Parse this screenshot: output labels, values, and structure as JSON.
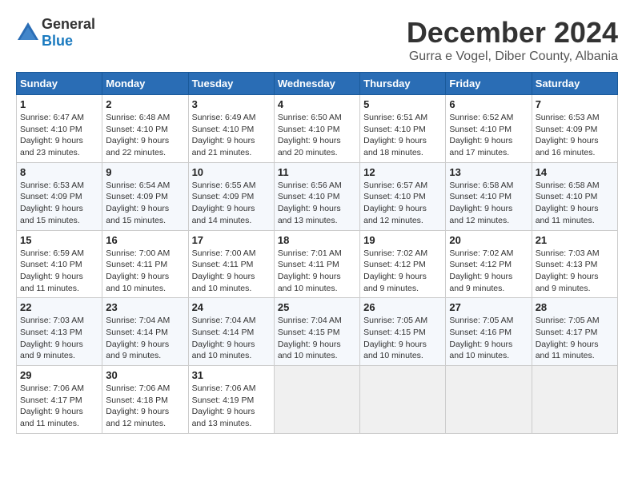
{
  "logo": {
    "general": "General",
    "blue": "Blue"
  },
  "title": "December 2024",
  "location": "Gurra e Vogel, Diber County, Albania",
  "headers": [
    "Sunday",
    "Monday",
    "Tuesday",
    "Wednesday",
    "Thursday",
    "Friday",
    "Saturday"
  ],
  "weeks": [
    [
      {
        "day": "1",
        "sunrise": "Sunrise: 6:47 AM",
        "sunset": "Sunset: 4:10 PM",
        "daylight": "Daylight: 9 hours and 23 minutes."
      },
      {
        "day": "2",
        "sunrise": "Sunrise: 6:48 AM",
        "sunset": "Sunset: 4:10 PM",
        "daylight": "Daylight: 9 hours and 22 minutes."
      },
      {
        "day": "3",
        "sunrise": "Sunrise: 6:49 AM",
        "sunset": "Sunset: 4:10 PM",
        "daylight": "Daylight: 9 hours and 21 minutes."
      },
      {
        "day": "4",
        "sunrise": "Sunrise: 6:50 AM",
        "sunset": "Sunset: 4:10 PM",
        "daylight": "Daylight: 9 hours and 20 minutes."
      },
      {
        "day": "5",
        "sunrise": "Sunrise: 6:51 AM",
        "sunset": "Sunset: 4:10 PM",
        "daylight": "Daylight: 9 hours and 18 minutes."
      },
      {
        "day": "6",
        "sunrise": "Sunrise: 6:52 AM",
        "sunset": "Sunset: 4:10 PM",
        "daylight": "Daylight: 9 hours and 17 minutes."
      },
      {
        "day": "7",
        "sunrise": "Sunrise: 6:53 AM",
        "sunset": "Sunset: 4:09 PM",
        "daylight": "Daylight: 9 hours and 16 minutes."
      }
    ],
    [
      {
        "day": "8",
        "sunrise": "Sunrise: 6:53 AM",
        "sunset": "Sunset: 4:09 PM",
        "daylight": "Daylight: 9 hours and 15 minutes."
      },
      {
        "day": "9",
        "sunrise": "Sunrise: 6:54 AM",
        "sunset": "Sunset: 4:09 PM",
        "daylight": "Daylight: 9 hours and 15 minutes."
      },
      {
        "day": "10",
        "sunrise": "Sunrise: 6:55 AM",
        "sunset": "Sunset: 4:09 PM",
        "daylight": "Daylight: 9 hours and 14 minutes."
      },
      {
        "day": "11",
        "sunrise": "Sunrise: 6:56 AM",
        "sunset": "Sunset: 4:10 PM",
        "daylight": "Daylight: 9 hours and 13 minutes."
      },
      {
        "day": "12",
        "sunrise": "Sunrise: 6:57 AM",
        "sunset": "Sunset: 4:10 PM",
        "daylight": "Daylight: 9 hours and 12 minutes."
      },
      {
        "day": "13",
        "sunrise": "Sunrise: 6:58 AM",
        "sunset": "Sunset: 4:10 PM",
        "daylight": "Daylight: 9 hours and 12 minutes."
      },
      {
        "day": "14",
        "sunrise": "Sunrise: 6:58 AM",
        "sunset": "Sunset: 4:10 PM",
        "daylight": "Daylight: 9 hours and 11 minutes."
      }
    ],
    [
      {
        "day": "15",
        "sunrise": "Sunrise: 6:59 AM",
        "sunset": "Sunset: 4:10 PM",
        "daylight": "Daylight: 9 hours and 11 minutes."
      },
      {
        "day": "16",
        "sunrise": "Sunrise: 7:00 AM",
        "sunset": "Sunset: 4:11 PM",
        "daylight": "Daylight: 9 hours and 10 minutes."
      },
      {
        "day": "17",
        "sunrise": "Sunrise: 7:00 AM",
        "sunset": "Sunset: 4:11 PM",
        "daylight": "Daylight: 9 hours and 10 minutes."
      },
      {
        "day": "18",
        "sunrise": "Sunrise: 7:01 AM",
        "sunset": "Sunset: 4:11 PM",
        "daylight": "Daylight: 9 hours and 10 minutes."
      },
      {
        "day": "19",
        "sunrise": "Sunrise: 7:02 AM",
        "sunset": "Sunset: 4:12 PM",
        "daylight": "Daylight: 9 hours and 9 minutes."
      },
      {
        "day": "20",
        "sunrise": "Sunrise: 7:02 AM",
        "sunset": "Sunset: 4:12 PM",
        "daylight": "Daylight: 9 hours and 9 minutes."
      },
      {
        "day": "21",
        "sunrise": "Sunrise: 7:03 AM",
        "sunset": "Sunset: 4:13 PM",
        "daylight": "Daylight: 9 hours and 9 minutes."
      }
    ],
    [
      {
        "day": "22",
        "sunrise": "Sunrise: 7:03 AM",
        "sunset": "Sunset: 4:13 PM",
        "daylight": "Daylight: 9 hours and 9 minutes."
      },
      {
        "day": "23",
        "sunrise": "Sunrise: 7:04 AM",
        "sunset": "Sunset: 4:14 PM",
        "daylight": "Daylight: 9 hours and 9 minutes."
      },
      {
        "day": "24",
        "sunrise": "Sunrise: 7:04 AM",
        "sunset": "Sunset: 4:14 PM",
        "daylight": "Daylight: 9 hours and 10 minutes."
      },
      {
        "day": "25",
        "sunrise": "Sunrise: 7:04 AM",
        "sunset": "Sunset: 4:15 PM",
        "daylight": "Daylight: 9 hours and 10 minutes."
      },
      {
        "day": "26",
        "sunrise": "Sunrise: 7:05 AM",
        "sunset": "Sunset: 4:15 PM",
        "daylight": "Daylight: 9 hours and 10 minutes."
      },
      {
        "day": "27",
        "sunrise": "Sunrise: 7:05 AM",
        "sunset": "Sunset: 4:16 PM",
        "daylight": "Daylight: 9 hours and 10 minutes."
      },
      {
        "day": "28",
        "sunrise": "Sunrise: 7:05 AM",
        "sunset": "Sunset: 4:17 PM",
        "daylight": "Daylight: 9 hours and 11 minutes."
      }
    ],
    [
      {
        "day": "29",
        "sunrise": "Sunrise: 7:06 AM",
        "sunset": "Sunset: 4:17 PM",
        "daylight": "Daylight: 9 hours and 11 minutes."
      },
      {
        "day": "30",
        "sunrise": "Sunrise: 7:06 AM",
        "sunset": "Sunset: 4:18 PM",
        "daylight": "Daylight: 9 hours and 12 minutes."
      },
      {
        "day": "31",
        "sunrise": "Sunrise: 7:06 AM",
        "sunset": "Sunset: 4:19 PM",
        "daylight": "Daylight: 9 hours and 13 minutes."
      },
      null,
      null,
      null,
      null
    ]
  ]
}
